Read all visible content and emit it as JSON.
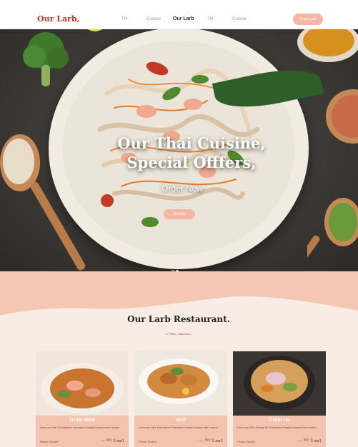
{
  "nav": {
    "logo": "Our Larb,",
    "links": [
      "Thi",
      "Cuisine",
      "Our Larb",
      "Thi",
      "Cuisine"
    ],
    "active_index": 2,
    "cta": "Food Larb"
  },
  "hero": {
    "title_line1": "Our Thai Cuisine,",
    "title_line2": "Special Offfers,",
    "order_label": "Order Now",
    "button_label": "Ord Nor"
  },
  "section": {
    "title": "Our Larb Restaurant.",
    "subtitle": "• • Yhen - Sidn hal • •"
  },
  "cards": [
    {
      "title": "Order Now",
      "text": "Lerer por Ser Freeinal ter Grenatou Fosnta Doeson fret Larbnn",
      "foot_left": "Peesn Tecsen",
      "foot_right": "— ᴲᴰᴼ 3 ⌀⌀1"
    },
    {
      "title": "Visit",
      "text": "Lerer por Seir Freenal ter Prenatou Fosnta Doeson fret Larbnn",
      "foot_left": "Peesn Tecsen",
      "foot_right": "— ᴲᴰᴼ 3 ⌀⌀1"
    },
    {
      "title": "Order Us",
      "text": "Lerer por Seir Freinal ter Pramatou Fosnta Doeson fret Lerbnn",
      "foot_left": "Peesn Tecsen",
      "foot_right": "— ᴲᴰᴼ 3 ⌀⌀1"
    }
  ],
  "colors": {
    "brand_red": "#c8312a",
    "accent_pink": "#f3b7a3",
    "section_bg": "#f5c8b6",
    "hero_bg": "#3d3b37"
  }
}
